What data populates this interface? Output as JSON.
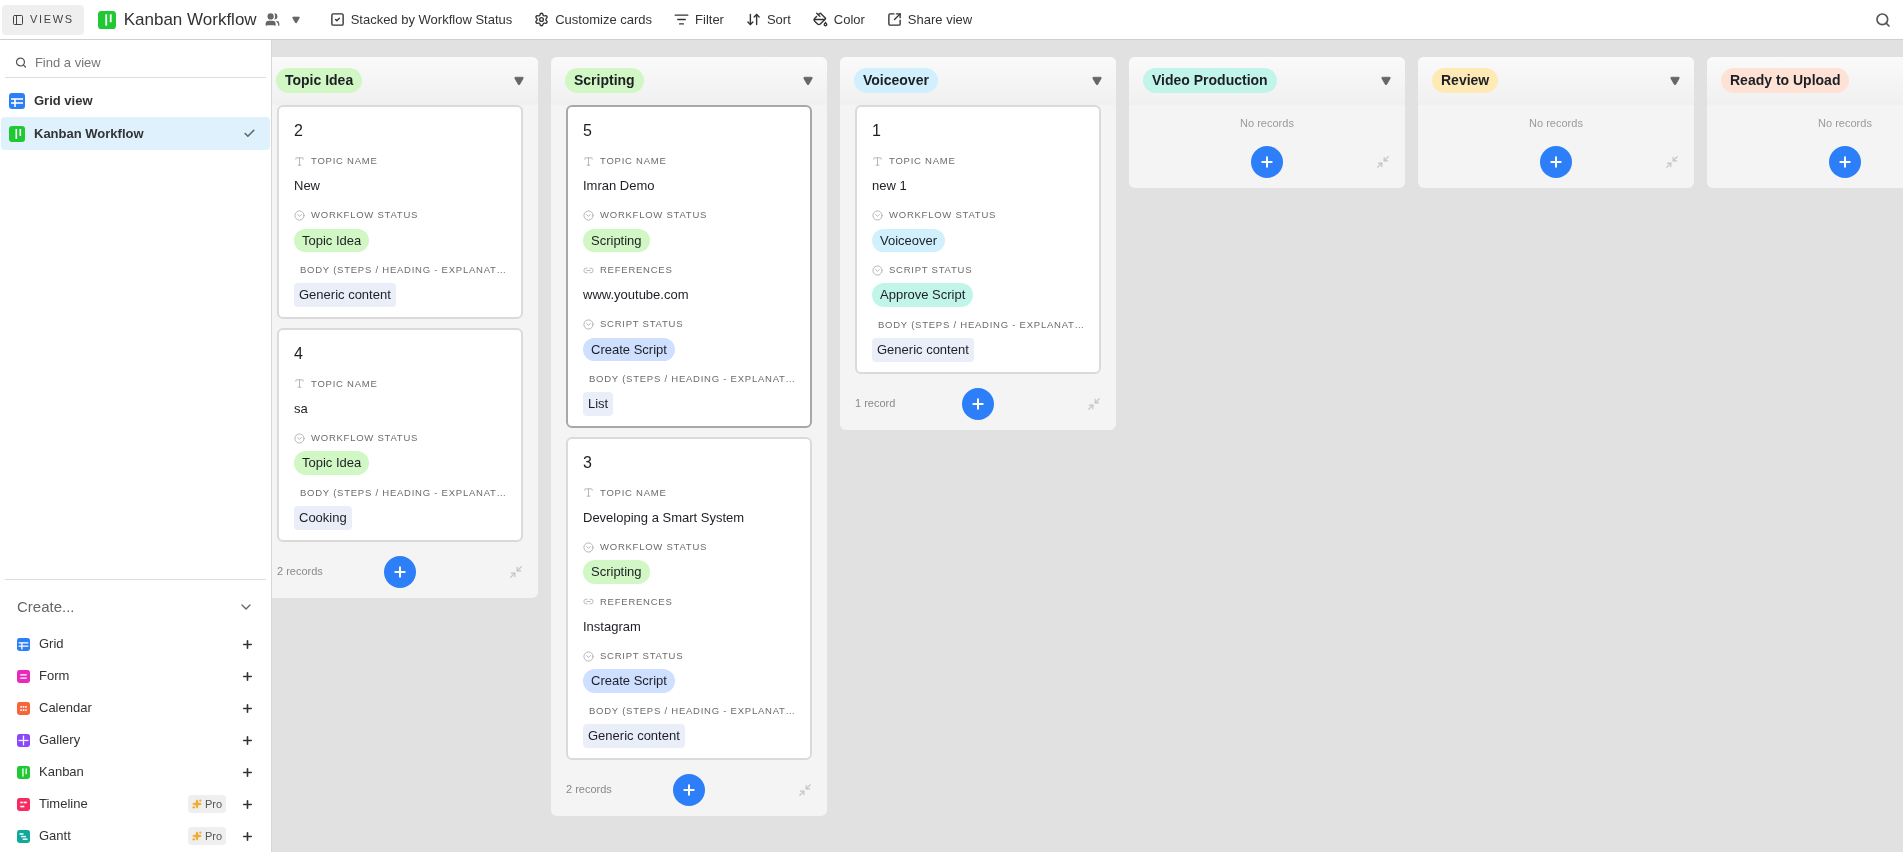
{
  "toolbar": {
    "views_button": "VIEWS",
    "view_name": "Kanban Workflow",
    "actions": [
      {
        "label": "Stacked by Workflow Status",
        "kind": "stack"
      },
      {
        "label": "Customize cards",
        "kind": "customize"
      },
      {
        "label": "Filter",
        "kind": "filter"
      },
      {
        "label": "Sort",
        "kind": "sort"
      },
      {
        "label": "Color",
        "kind": "color"
      },
      {
        "label": "Share view",
        "kind": "share"
      }
    ]
  },
  "sidebar": {
    "search": {
      "placeholder": "Find a view"
    },
    "views": [
      {
        "label": "Grid view",
        "kind": "grid",
        "color": "#2d7ff9",
        "selected": false
      },
      {
        "label": "Kanban Workflow",
        "kind": "kanban",
        "color": "#20c933",
        "selected": true
      }
    ],
    "create": {
      "title": "Create...",
      "items": [
        {
          "label": "Grid",
          "kind": "grid",
          "color": "#2d7ff9"
        },
        {
          "label": "Form",
          "kind": "form",
          "color": "#e929ba"
        },
        {
          "label": "Calendar",
          "kind": "calendar",
          "color": "#f7653b"
        },
        {
          "label": "Gallery",
          "kind": "gallery",
          "color": "#8b46ff"
        },
        {
          "label": "Kanban",
          "kind": "kanban",
          "color": "#20c933"
        },
        {
          "label": "Timeline",
          "kind": "timeline",
          "color": "#f82b60",
          "badge": "Pro"
        },
        {
          "label": "Gantt",
          "kind": "gantt",
          "color": "#11a99c",
          "badge": "Pro"
        }
      ]
    }
  },
  "columns": [
    {
      "title": "Topic Idea",
      "color": "#d1f7c4",
      "footer": "2 records",
      "cards": [
        {
          "number": "2",
          "selected": false,
          "fields": [
            {
              "label": "TOPIC NAME",
              "kind": "text",
              "value": "New"
            },
            {
              "label": "WORKFLOW STATUS",
              "kind": "select",
              "value": "Topic Idea",
              "color": "#d1f7c4"
            },
            {
              "label": "BODY (STEPS / HEADING - EXPLANAT…",
              "kind": "multi",
              "value": "Generic content"
            }
          ]
        },
        {
          "number": "4",
          "selected": false,
          "fields": [
            {
              "label": "TOPIC NAME",
              "kind": "text",
              "value": "sa"
            },
            {
              "label": "WORKFLOW STATUS",
              "kind": "select",
              "value": "Topic Idea",
              "color": "#d1f7c4"
            },
            {
              "label": "BODY (STEPS / HEADING - EXPLANAT…",
              "kind": "multi",
              "value": "Cooking"
            }
          ]
        }
      ]
    },
    {
      "title": "Scripting",
      "color": "#d1f7c4",
      "footer": "2 records",
      "cards": [
        {
          "number": "5",
          "selected": true,
          "fields": [
            {
              "label": "TOPIC NAME",
              "kind": "text",
              "value": "Imran Demo"
            },
            {
              "label": "WORKFLOW STATUS",
              "kind": "select",
              "value": "Scripting",
              "color": "#d1f7c4"
            },
            {
              "label": "REFERENCES",
              "kind": "url",
              "value": "www.youtube.com"
            },
            {
              "label": "SCRIPT STATUS",
              "kind": "select",
              "value": "Create Script",
              "color": "#cfdfff"
            },
            {
              "label": "BODY (STEPS / HEADING - EXPLANAT…",
              "kind": "multi",
              "value": "List"
            }
          ]
        },
        {
          "number": "3",
          "selected": false,
          "fields": [
            {
              "label": "TOPIC NAME",
              "kind": "text",
              "value": "Developing a Smart System"
            },
            {
              "label": "WORKFLOW STATUS",
              "kind": "select",
              "value": "Scripting",
              "color": "#d1f7c4"
            },
            {
              "label": "REFERENCES",
              "kind": "url",
              "value": "Instagram"
            },
            {
              "label": "SCRIPT STATUS",
              "kind": "select",
              "value": "Create Script",
              "color": "#cfdfff"
            },
            {
              "label": "BODY (STEPS / HEADING - EXPLANAT…",
              "kind": "multi",
              "value": "Generic content"
            }
          ]
        }
      ]
    },
    {
      "title": "Voiceover",
      "color": "#d0f0fd",
      "footer": "1 record",
      "cards": [
        {
          "number": "1",
          "selected": false,
          "fields": [
            {
              "label": "TOPIC NAME",
              "kind": "text",
              "value": "new 1"
            },
            {
              "label": "WORKFLOW STATUS",
              "kind": "select",
              "value": "Voiceover",
              "color": "#d0f0fd"
            },
            {
              "label": "SCRIPT STATUS",
              "kind": "select",
              "value": "Approve Script",
              "color": "#c2f5e9"
            },
            {
              "label": "BODY (STEPS / HEADING - EXPLANAT…",
              "kind": "multi",
              "value": "Generic content"
            }
          ]
        }
      ]
    },
    {
      "title": "Video Production",
      "color": "#c2f5e9",
      "empty_text": "No records"
    },
    {
      "title": "Review",
      "color": "#ffeab6",
      "empty_text": "No records"
    },
    {
      "title": "Ready to Upload",
      "color": "#fee2d5",
      "empty_text": "No records"
    }
  ]
}
